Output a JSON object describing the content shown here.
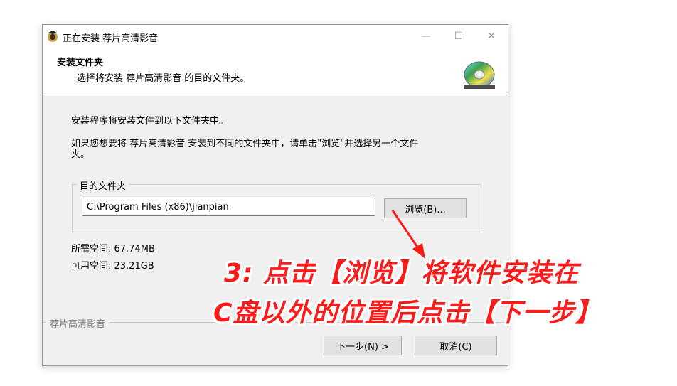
{
  "window": {
    "title": "正在安装 荐片高清影音",
    "minimize_glyph": "—",
    "maximize_glyph": "☐",
    "close_glyph": "✕"
  },
  "header": {
    "title": "安装文件夹",
    "subtitle": "选择将安装 荐片高清影音 的目的文件夹。"
  },
  "body": {
    "line1": "安装程序将安装文件到以下文件夹中。",
    "line2a": "如果您想要将 荐片高清影音 安装到不同的文件夹中，请单击\"浏览\"并选择另一个文件",
    "line2b": "夹。"
  },
  "folder_group": {
    "label": "目的文件夹",
    "path_value": "C:\\Program Files (x86)\\jianpian",
    "browse_label": "浏览(B)..."
  },
  "space": {
    "required": "所需空间: 67.74MB",
    "available": "可用空间: 23.21GB"
  },
  "branding": "荐片高清影音",
  "buttons": {
    "next": "下一步(N) >",
    "cancel": "取消(C)"
  },
  "annotation": {
    "line1": "3: 点击【浏览】将软件安装在",
    "line2": "C盘以外的位置后点击【下一步】",
    "color": "#ff1a1a"
  },
  "icons": {
    "app": "installer-app-icon",
    "cd": "cd-disc-icon",
    "arrow": "red-arrow-icon"
  }
}
